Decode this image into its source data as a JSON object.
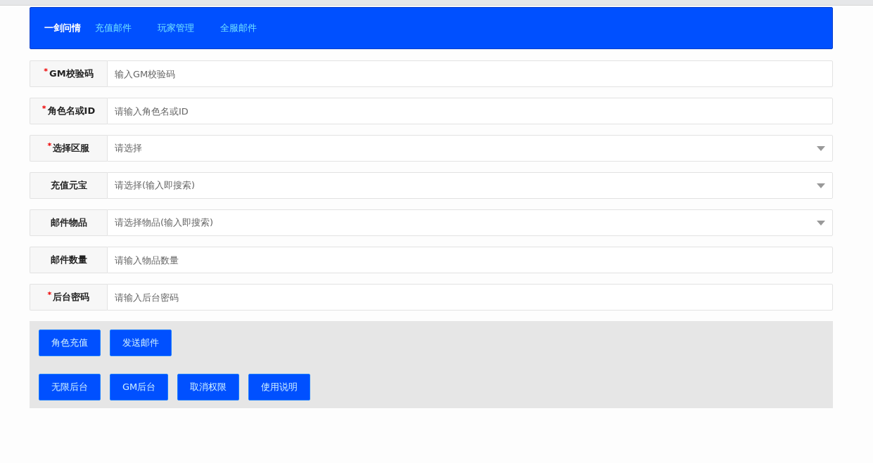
{
  "nav": {
    "brand": "一剑问情",
    "links": [
      "充值邮件",
      "玩家管理",
      "全服邮件"
    ]
  },
  "fields": [
    {
      "mark": "*",
      "label": "GM校验码",
      "kind": "input",
      "placeholder": "输入GM校验码"
    },
    {
      "mark": "*",
      "label": "角色名或ID",
      "kind": "input",
      "placeholder": "请输入角色名或ID"
    },
    {
      "mark": "*",
      "label": "选择区服",
      "kind": "select",
      "placeholder": "请选择"
    },
    {
      "label": "充值元宝",
      "kind": "select",
      "placeholder": "请选择(输入即搜索)"
    },
    {
      "label": "邮件物品",
      "kind": "select",
      "placeholder": "请选择物品(输入即搜索)"
    },
    {
      "label": "邮件数量",
      "kind": "input",
      "placeholder": "请输入物品数量"
    },
    {
      "mark": "*",
      "label": "后台密码",
      "kind": "input",
      "placeholder": "请输入后台密码"
    }
  ],
  "button_rows": [
    [
      "角色充值",
      "发送邮件"
    ],
    [
      "无限后台",
      "GM后台",
      "取消权限",
      "使用说明"
    ]
  ]
}
